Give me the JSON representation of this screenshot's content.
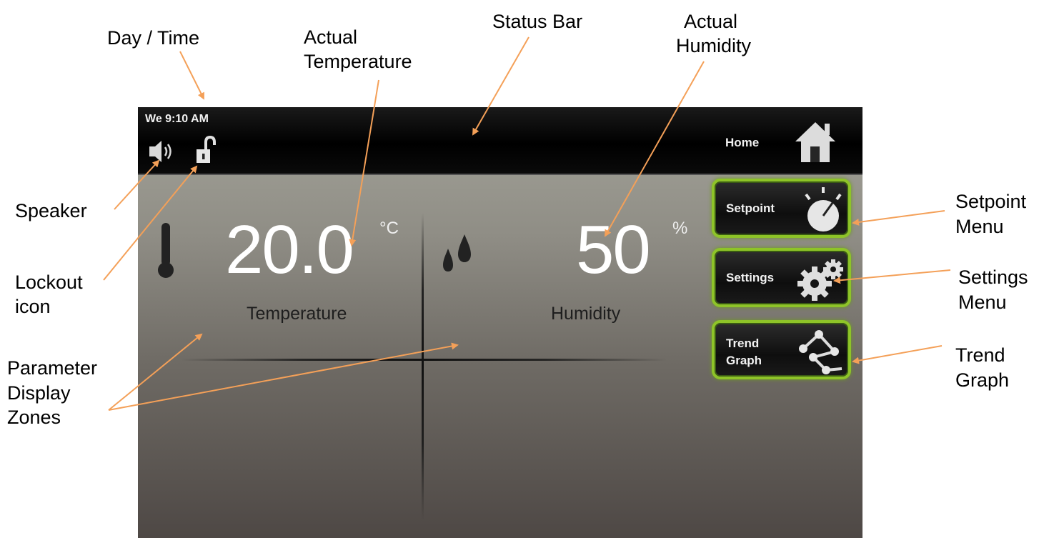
{
  "annotations": {
    "day_time": "Day / Time",
    "actual_temperature_line1": "Actual",
    "actual_temperature_line2": "Temperature",
    "status_bar": "Status Bar",
    "actual_humidity_line1": "Actual",
    "actual_humidity_line2": "Humidity",
    "speaker": "Speaker",
    "lockout_line1": "Lockout",
    "lockout_line2": "icon",
    "parameter_line1": "Parameter",
    "parameter_line2": "Display",
    "parameter_line3": "Zones",
    "setpoint_menu_line1": "Setpoint",
    "setpoint_menu_line2": "Menu",
    "settings_menu_line1": "Settings",
    "settings_menu_line2": "Menu",
    "trend_graph_line1": "Trend",
    "trend_graph_line2": "Graph",
    "arrow_color": "#f4a058"
  },
  "status_bar": {
    "datetime": "We 9:10 AM",
    "home_label": "Home",
    "icons": [
      "speaker-icon",
      "unlocked-padlock-icon",
      "home-icon"
    ]
  },
  "zones": {
    "temperature": {
      "value": "20.0",
      "unit": "°C",
      "label": "Temperature",
      "icon": "thermometer-icon"
    },
    "humidity": {
      "value": "50",
      "unit": "%",
      "label": "Humidity",
      "icon": "water-drops-icon"
    }
  },
  "menu": {
    "setpoint": {
      "label": "Setpoint",
      "icon": "dial-icon"
    },
    "settings": {
      "label": "Settings",
      "icon": "gears-icon"
    },
    "trend_graph": {
      "label_line1": "Trend",
      "label_line2": "Graph",
      "icon": "graph-nodes-icon"
    },
    "accent_color": "#8ec428"
  }
}
